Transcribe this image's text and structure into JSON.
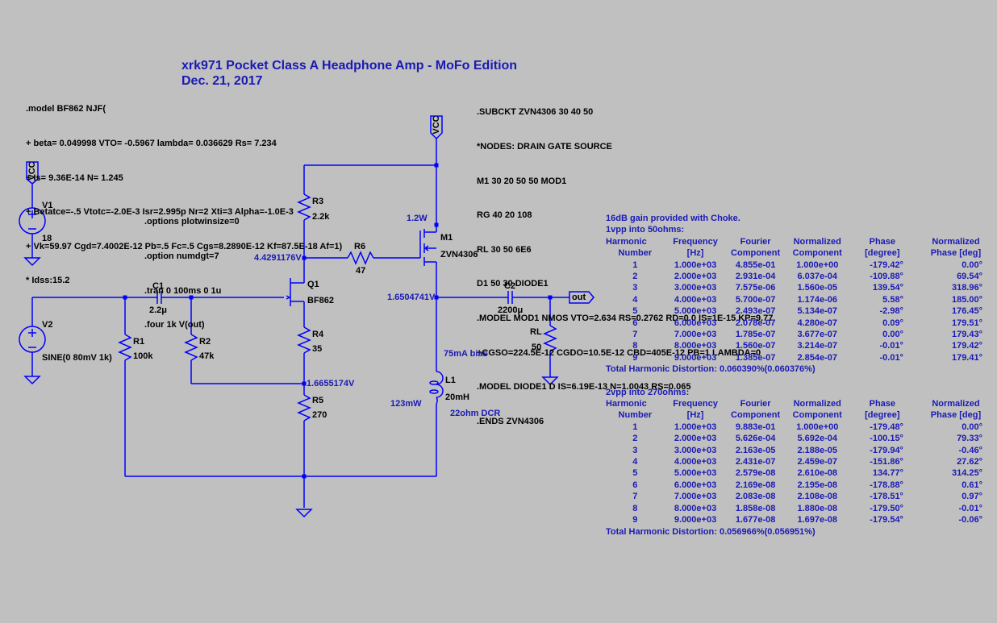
{
  "title": {
    "line1": "xrk971 Pocket Class A Headphone Amp - MoFo Edition",
    "line2": "Dec. 21, 2017"
  },
  "bf862_model": [
    ".model BF862 NJF(",
    "+ beta= 0.049998 VTO= -0.5967 lambda= 0.036629 Rs= 7.234",
    "+ Is= 9.36E-14 N= 1.245",
    "+ Betatce=-.5 Vtotc=-2.0E-3 Isr=2.995p Nr=2 Xti=3 Alpha=-1.0E-3",
    "+ Vk=59.97 Cgd=7.4002E-12 Pb=.5 Fc=.5 Cgs=8.2890E-12 Kf=87.5E-18 Af=1)",
    "* Idss:15.2"
  ],
  "zvn_subckt": [
    ".SUBCKT ZVN4306 30 40 50",
    "*NODES: DRAIN GATE SOURCE",
    "M1 30 20 50 50 MOD1",
    "RG 40 20 108",
    "RL 30 50 6E6",
    "D1 50 30 DIODE1",
    ".MODEL MOD1 NMOS VTO=2.634 RS=0.2762 RD=0.0 IS=1E-15 KP=9.77",
    "+CGSO=224.5E-12 CGDO=10.5E-12 CBD=405E-12 PB=1 LAMBDA=0",
    ".MODEL DIODE1 D IS=6.19E-13 N=1.0043 RS=0.065",
    ".ENDS ZVN4306"
  ],
  "spice_directives": [
    ".options plotwinsize=0",
    ".option numdgt=7",
    ".tran 0 100ms 0 1u",
    ".four 1k V(out)"
  ],
  "components": {
    "V1": {
      "name": "V1",
      "value": "18"
    },
    "V2": {
      "name": "V2",
      "value": "SINE(0 80mV 1k)"
    },
    "C1": {
      "name": "C1",
      "value": "2.2μ"
    },
    "C2": {
      "name": "C2",
      "value": "2200μ"
    },
    "R1": {
      "name": "R1",
      "value": "100k"
    },
    "R2": {
      "name": "R2",
      "value": "47k"
    },
    "R3": {
      "name": "R3",
      "value": "2.2k"
    },
    "R4": {
      "name": "R4",
      "value": "35"
    },
    "R5": {
      "name": "R5",
      "value": "270"
    },
    "R6": {
      "name": "R6",
      "value": "47"
    },
    "RL": {
      "name": "RL",
      "value": "50"
    },
    "L1": {
      "name": "L1",
      "value": "20mH"
    },
    "Q1": {
      "name": "Q1",
      "value": "BF862"
    },
    "M1": {
      "name": "M1",
      "value": "ZVN4306"
    }
  },
  "net_labels": {
    "vcc": "VCC",
    "out": "out"
  },
  "annotations": {
    "v_drain_q1": "4.4291176V",
    "v_source_m1": "1.6504741V",
    "v_r4r5": "1.6655174V",
    "m1_power": "1.2W",
    "bias": "75mA bias",
    "l1_power": "123mW",
    "l1_dcr": "22ohm DCR"
  },
  "fourier": {
    "intro": "16dB gain provided with Choke.",
    "headers": [
      [
        "Harmonic",
        "Frequency",
        "Fourier",
        "Normalized",
        "Phase",
        "Normalized"
      ],
      [
        "Number",
        "[Hz]",
        "Component",
        "Component",
        "[degree]",
        "Phase [deg]"
      ]
    ],
    "tables": [
      {
        "caption": "1vpp into 50ohms:",
        "rows": [
          [
            "1",
            "1.000e+03",
            "4.855e-01",
            "1.000e+00",
            "-179.42°",
            "0.00°"
          ],
          [
            "2",
            "2.000e+03",
            "2.931e-04",
            "6.037e-04",
            "-109.88°",
            "69.54°"
          ],
          [
            "3",
            "3.000e+03",
            "7.575e-06",
            "1.560e-05",
            "139.54°",
            "318.96°"
          ],
          [
            "4",
            "4.000e+03",
            "5.700e-07",
            "1.174e-06",
            "5.58°",
            "185.00°"
          ],
          [
            "5",
            "5.000e+03",
            "2.493e-07",
            "5.134e-07",
            "-2.98°",
            "176.45°"
          ],
          [
            "6",
            "6.000e+03",
            "2.078e-07",
            "4.280e-07",
            "0.09°",
            "179.51°"
          ],
          [
            "7",
            "7.000e+03",
            "1.785e-07",
            "3.677e-07",
            "0.00°",
            "179.43°"
          ],
          [
            "8",
            "8.000e+03",
            "1.560e-07",
            "3.214e-07",
            "-0.01°",
            "179.42°"
          ],
          [
            "9",
            "9.000e+03",
            "1.385e-07",
            "2.854e-07",
            "-0.01°",
            "179.41°"
          ]
        ],
        "thd": "Total Harmonic Distortion: 0.060390%(0.060376%)"
      },
      {
        "caption": "2vpp into 270ohms:",
        "rows": [
          [
            "1",
            "1.000e+03",
            "9.883e-01",
            "1.000e+00",
            "-179.48°",
            "0.00°"
          ],
          [
            "2",
            "2.000e+03",
            "5.626e-04",
            "5.692e-04",
            "-100.15°",
            "79.33°"
          ],
          [
            "3",
            "3.000e+03",
            "2.163e-05",
            "2.188e-05",
            "-179.94°",
            "-0.46°"
          ],
          [
            "4",
            "4.000e+03",
            "2.431e-07",
            "2.459e-07",
            "-151.86°",
            "27.62°"
          ],
          [
            "5",
            "5.000e+03",
            "2.579e-08",
            "2.610e-08",
            "134.77°",
            "314.25°"
          ],
          [
            "6",
            "6.000e+03",
            "2.169e-08",
            "2.195e-08",
            "-178.88°",
            "0.61°"
          ],
          [
            "7",
            "7.000e+03",
            "2.083e-08",
            "2.108e-08",
            "-178.51°",
            "0.97°"
          ],
          [
            "8",
            "8.000e+03",
            "1.858e-08",
            "1.880e-08",
            "-179.50°",
            "-0.01°"
          ],
          [
            "9",
            "9.000e+03",
            "1.677e-08",
            "1.697e-08",
            "-179.54°",
            "-0.06°"
          ]
        ],
        "thd": "Total Harmonic Distortion: 0.056966%(0.056951%)"
      }
    ]
  },
  "colors": {
    "background": "#c0c0c0",
    "wire": "#0000ff",
    "annotation_text": "#1a1ab4",
    "component_text": "#000000"
  }
}
